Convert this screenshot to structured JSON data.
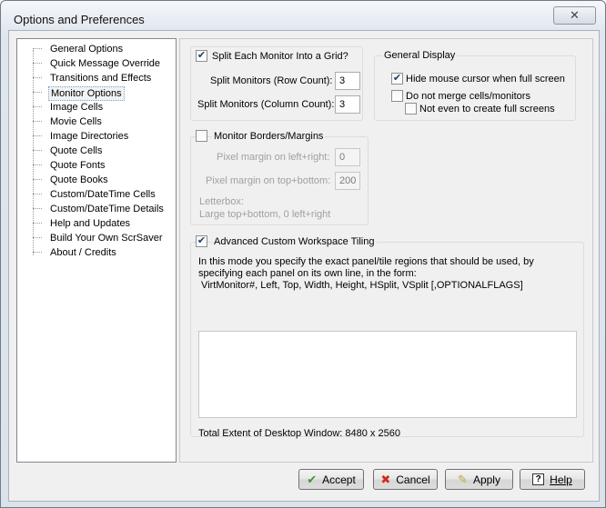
{
  "window": {
    "title": "Options and Preferences",
    "close_glyph": "✕"
  },
  "sidebar": {
    "items": [
      {
        "label": "General Options"
      },
      {
        "label": "Quick Message Override"
      },
      {
        "label": "Transitions and Effects"
      },
      {
        "label": "Monitor Options",
        "selected": true
      },
      {
        "label": "Image Cells"
      },
      {
        "label": "Movie Cells"
      },
      {
        "label": "Image Directories"
      },
      {
        "label": "Quote Cells"
      },
      {
        "label": "Quote Fonts"
      },
      {
        "label": "Quote Books"
      },
      {
        "label": "Custom/DateTime Cells"
      },
      {
        "label": "Custom/DateTime Details"
      },
      {
        "label": "Help and Updates"
      },
      {
        "label": "Build Your Own ScrSaver"
      },
      {
        "label": "About / Credits"
      }
    ]
  },
  "grid": {
    "checkbox_label": "Split Each Monitor Into a Grid?",
    "checked": true,
    "row_label": "Split Monitors (Row Count):",
    "row_value": "3",
    "col_label": "Split Monitors (Column Count):",
    "col_value": "3"
  },
  "display": {
    "group_title": "General Display",
    "hide_cursor_label": "Hide mouse cursor when full screen",
    "hide_cursor_checked": true,
    "no_merge_label": "Do not merge cells/monitors",
    "no_merge_checked": false,
    "not_even_label": "Not even to create full screens",
    "not_even_checked": false
  },
  "borders": {
    "checkbox_label": "Monitor Borders/Margins",
    "checked": false,
    "lr_label": "Pixel margin on left+right:",
    "lr_value": "0",
    "tb_label": "Pixel margin on top+bottom:",
    "tb_value": "200",
    "letterbox_line1": "Letterbox:",
    "letterbox_line2": "Large top+bottom, 0 left+right"
  },
  "tiling": {
    "checkbox_label": "Advanced Custom Workspace Tiling",
    "checked": true,
    "desc_line1": "In this mode you specify the exact panel/tile regions that should be used, by",
    "desc_line2": "specifying each panel on its own line, in the form:",
    "desc_line3": " VirtMonitor#, Left, Top, Width, Height, HSplit, VSplit [,OPTIONALFLAGS]",
    "textarea_value": "",
    "extent_label": "Total Extent of Desktop Window: 8480 x 2560"
  },
  "buttons": {
    "accept": "Accept",
    "cancel": "Cancel",
    "apply": "Apply",
    "help": "Help"
  },
  "colors": {
    "accept_icon": "#3a9a2a",
    "cancel_icon": "#d42a1e",
    "apply_icon": "#c8a33a"
  }
}
